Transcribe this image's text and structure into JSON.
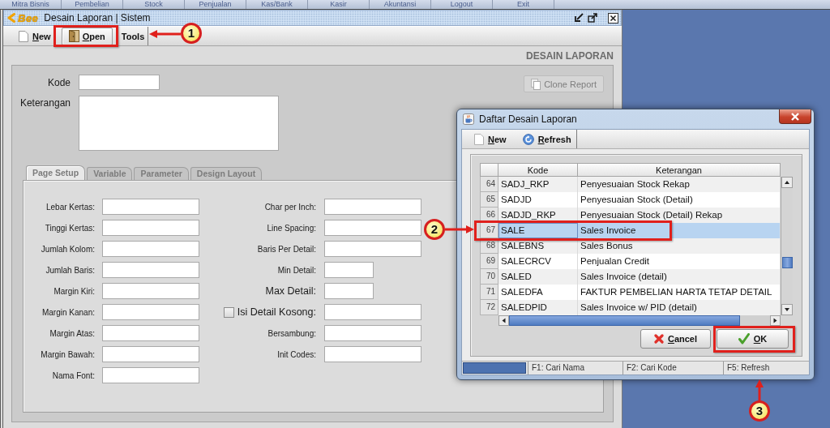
{
  "menu_bar": {
    "items": [
      "Mitra Bisnis",
      "Pembelian",
      "Stock",
      "Penjualan",
      "Kas/Bank",
      "Kasir",
      "Akuntansi",
      "Logout",
      "Exit"
    ]
  },
  "window": {
    "logo": "Bee",
    "title": "Desain Laporan | Sistem"
  },
  "toolbar": {
    "buttons": [
      {
        "kind": "new",
        "label": "New",
        "highlighted": false
      },
      {
        "kind": "open",
        "label": "Open",
        "highlighted": true
      },
      {
        "kind": "menu",
        "label": "Tools",
        "highlighted": false
      }
    ]
  },
  "page_heading": "DESAIN LAPORAN",
  "form": {
    "fields": [
      {
        "kind": "text",
        "label": "Kode"
      },
      {
        "kind": "textarea",
        "label": "Keterangan"
      }
    ],
    "clone_button": {
      "label": "Clone Report",
      "disabled": true
    }
  },
  "tabs": [
    {
      "label": "Page Setup",
      "selected": true,
      "disabled": true
    },
    {
      "label": "Variable",
      "selected": false,
      "disabled": true
    },
    {
      "label": "Parameter",
      "selected": false,
      "disabled": true
    },
    {
      "label": "Design Layout",
      "selected": false,
      "disabled": true
    }
  ],
  "page_setup": {
    "left": [
      {
        "label": "Lebar Kertas:"
      },
      {
        "label": "Tinggi Kertas:"
      },
      {
        "label": "Jumlah Kolom:"
      },
      {
        "label": "Jumlah Baris:"
      },
      {
        "label": "Margin Kiri:"
      },
      {
        "label": "Margin Kanan:"
      },
      {
        "label": "Margin Atas:"
      },
      {
        "label": "Margin Bawah:"
      },
      {
        "label": "Nama Font:"
      }
    ],
    "right": [
      {
        "kind": "field",
        "label": "Char per Inch:"
      },
      {
        "kind": "field",
        "label": "Line Spacing:"
      },
      {
        "kind": "field",
        "label": "Baris Per Detail:"
      },
      {
        "kind": "short",
        "label": "Min Detail:"
      },
      {
        "kind": "short",
        "label": "Max Detail:"
      },
      {
        "kind": "checkbox",
        "label": "Isi Detail Kosong:",
        "checked": false
      },
      {
        "kind": "field",
        "label": "Bersambung:"
      },
      {
        "kind": "field",
        "label": "Init Codes:"
      }
    ]
  },
  "dialog": {
    "title": "Daftar Desain Laporan",
    "toolbar": [
      {
        "kind": "new",
        "label": "New"
      },
      {
        "kind": "refresh",
        "label": "Refresh"
      }
    ],
    "table": {
      "columns": [
        "Kode",
        "Keterangan"
      ],
      "rows": [
        {
          "number": "64",
          "kode": "SADJ_RKP",
          "keterangan": "Penyesuaian Stock Rekap",
          "selected": false
        },
        {
          "number": "65",
          "kode": "SADJD",
          "keterangan": "Penyesuaian Stock (Detail)",
          "selected": false
        },
        {
          "number": "66",
          "kode": "SADJD_RKP",
          "keterangan": "Penyesuaian Stock (Detail) Rekap",
          "selected": false
        },
        {
          "number": "67",
          "kode": "SALE",
          "keterangan": "Sales Invoice",
          "selected": true
        },
        {
          "number": "68",
          "kode": "SALEBNS",
          "keterangan": "Sales Bonus",
          "selected": false
        },
        {
          "number": "69",
          "kode": "SALECRCV",
          "keterangan": "Penjualan Credit",
          "selected": false
        },
        {
          "number": "70",
          "kode": "SALED",
          "keterangan": "Sales Invoice (detail)",
          "selected": false
        },
        {
          "number": "71",
          "kode": "SALEDFA",
          "keterangan": "FAKTUR PEMBELIAN HARTA TETAP DETAIL",
          "selected": false
        },
        {
          "number": "72",
          "kode": "SALEDPID",
          "keterangan": "Sales Invoice w/ PID (detail)",
          "selected": false
        }
      ]
    },
    "buttons": [
      {
        "kind": "cancel",
        "label": "Cancel"
      },
      {
        "kind": "ok",
        "label": "OK"
      }
    ],
    "status_bar": [
      "F1: Cari Nama",
      "F2: Cari Kode",
      "F5: Refresh"
    ]
  },
  "annotations": [
    {
      "label": "1"
    },
    {
      "label": "2"
    },
    {
      "label": "3"
    }
  ]
}
